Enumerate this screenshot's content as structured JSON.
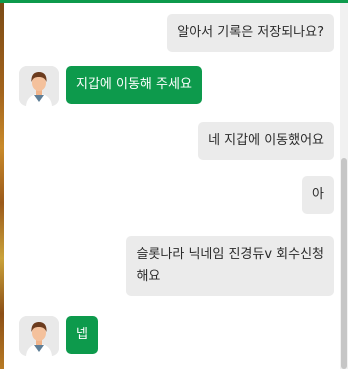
{
  "colors": {
    "accent": "#0d9a4c",
    "incoming_bubble": "#ebebeb",
    "outgoing_text": "#ffffff"
  },
  "messages": [
    {
      "side": "right",
      "text": "알아서 기록은 저장되나요?"
    },
    {
      "side": "left",
      "text": "지갑에 이동해 주세요",
      "avatar_icon": "user-avatar-icon"
    },
    {
      "side": "right",
      "text": "네 지갑에 이동했어요"
    },
    {
      "side": "right",
      "text": "아"
    },
    {
      "side": "right",
      "lines": [
        "슬롯나라 닉네임 진경듀v 회수신청",
        "해요"
      ]
    },
    {
      "side": "left",
      "text": "넵",
      "avatar_icon": "user-avatar-icon"
    }
  ]
}
